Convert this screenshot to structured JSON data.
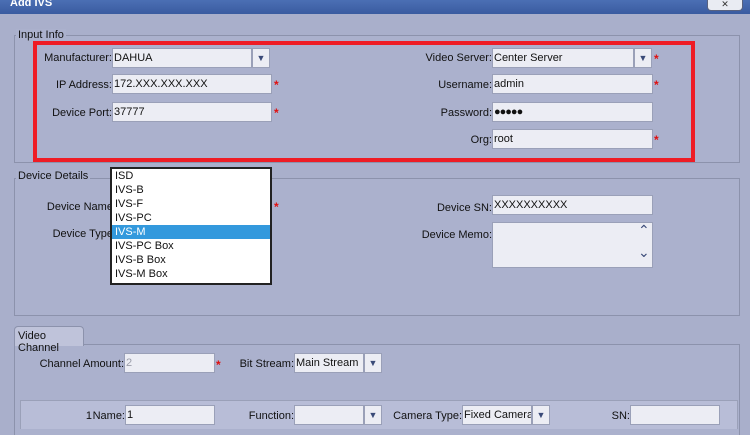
{
  "window": {
    "title": "Add IVS",
    "close_glyph": "✕"
  },
  "input_info": {
    "section_label": "Input Info",
    "manufacturer": {
      "label": "Manufacturer:",
      "value": "DAHUA"
    },
    "ip_address": {
      "label": "IP Address:",
      "value": "172.XXX.XXX.XXX"
    },
    "device_port": {
      "label": "Device Port:",
      "value": "37777"
    },
    "video_server": {
      "label": "Video Server:",
      "value": "Center Server"
    },
    "username": {
      "label": "Username:",
      "value": "admin"
    },
    "password": {
      "label": "Password:",
      "value": "●●●●●"
    },
    "org": {
      "label": "Org:",
      "value": "root"
    }
  },
  "device_details": {
    "section_label": "Device Details",
    "device_name": {
      "label": "Device Name:"
    },
    "device_type": {
      "label": "Device Type:"
    },
    "device_sn": {
      "label": "Device SN:",
      "value": "XXXXXXXXXX"
    },
    "device_memo": {
      "label": "Device Memo:"
    }
  },
  "device_type_options": [
    "ISD",
    "IVS-B",
    "IVS-F",
    "IVS-PC",
    "IVS-M",
    "IVS-PC Box",
    "IVS-B Box",
    "IVS-M Box"
  ],
  "device_type_selected": "IVS-M",
  "video_channel": {
    "tab_label": "Video Channel",
    "channel_amount": {
      "label": "Channel Amount:",
      "value": "2"
    },
    "bit_stream": {
      "label": "Bit Stream:",
      "value": "Main Stream"
    },
    "row": {
      "index": "1",
      "name_label": "Name:",
      "name_value": "1",
      "function_label": "Function:",
      "function_value": "",
      "camera_type_label": "Camera Type:",
      "camera_type_value": "Fixed Camera",
      "sn_label": "SN:",
      "sn_value": ""
    }
  },
  "required_mark": "*",
  "icons": {
    "dropdown": "▼",
    "scroll_up": "⌃",
    "scroll_down": "⌄"
  },
  "colors": {
    "highlight_box": "#ee1c25",
    "selection": "#3399dd",
    "required": "#e01010"
  }
}
